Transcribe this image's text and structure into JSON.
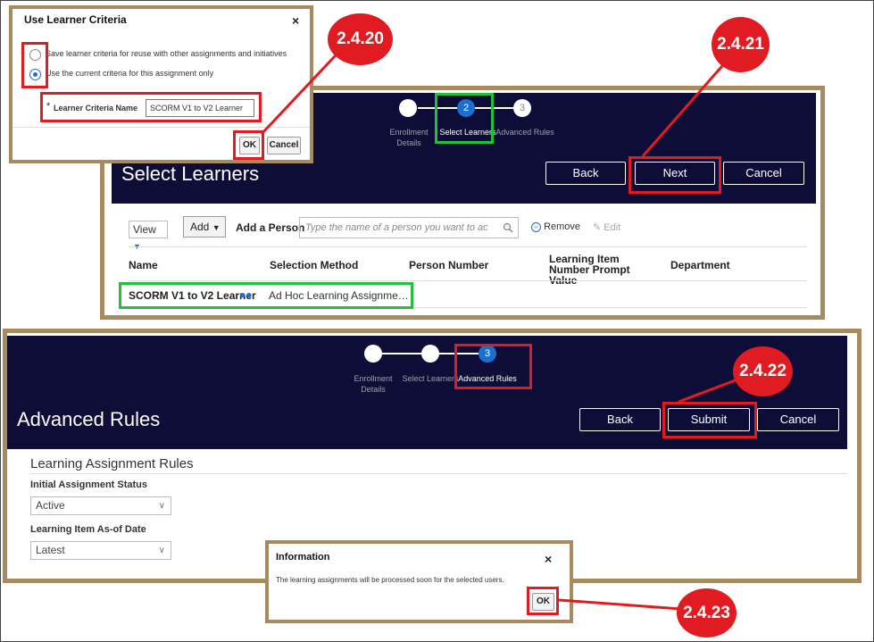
{
  "dialog1": {
    "title": "Use Learner Criteria",
    "close": "×",
    "option1": "Save learner criteria for reuse with other assignments and initiatives",
    "option2": "Use the current criteria for this assignment only",
    "field_required": "*",
    "field_label": "Learner Criteria Name",
    "field_value": "SCORM V1 to V2 Learner",
    "ok": "OK",
    "cancel": "Cancel"
  },
  "callouts": [
    "2.4.20",
    "2.4.21",
    "2.4.22",
    "2.4.23"
  ],
  "select_learners": {
    "steps": [
      {
        "num": "",
        "label": "Enrollment Details"
      },
      {
        "num": "2",
        "label": "Select Learners"
      },
      {
        "num": "3",
        "label": "Advanced Rules"
      }
    ],
    "title": "Select Learners",
    "back": "Back",
    "next": "Next",
    "cancel": "Cancel",
    "view": "View",
    "add": "Add",
    "add_person": "Add a Person",
    "search_placeholder": "Type the name of a person you want to ac",
    "remove": "Remove",
    "edit": "Edit",
    "columns": [
      "Name",
      "Selection Method",
      "Person Number",
      "Learning Item Number Prompt Value",
      "Department"
    ],
    "row": {
      "name": "SCORM V1 to V2 Learner",
      "method": "Ad Hoc Learning Assignme…"
    }
  },
  "advanced_rules": {
    "steps": [
      {
        "num": "",
        "label": "Enrollment Details"
      },
      {
        "num": "",
        "label": "Select Learners"
      },
      {
        "num": "3",
        "label": "Advanced Rules"
      }
    ],
    "title": "Advanced Rules",
    "back": "Back",
    "submit": "Submit",
    "cancel": "Cancel",
    "section_title": "Learning Assignment Rules",
    "status_label": "Initial Assignment Status",
    "status_value": "Active",
    "asof_label": "Learning Item As-of Date",
    "asof_value": "Latest"
  },
  "info_dialog": {
    "title": "Information",
    "close": "×",
    "message": "The learning assignments will be processed soon for the selected users.",
    "ok": "OK"
  },
  "colors": {
    "navy": "#0e0d38",
    "accent_blue": "#1a6fd1",
    "callout_red": "#e11b22",
    "frame_brown": "#a88a60",
    "highlight_green": "#22c03b"
  }
}
